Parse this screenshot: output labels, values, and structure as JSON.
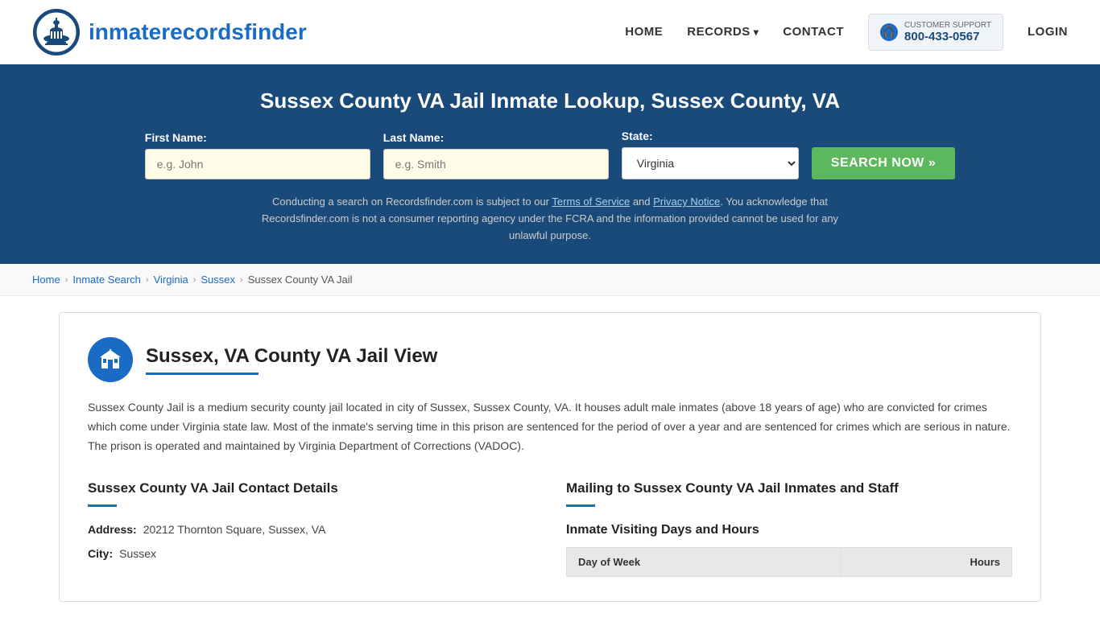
{
  "header": {
    "logo_text_part1": "inmaterecords",
    "logo_text_part2": "finder",
    "nav": {
      "home": "HOME",
      "records": "RECORDS",
      "contact": "CONTACT",
      "login": "LOGIN"
    },
    "support": {
      "label": "CUSTOMER SUPPORT",
      "number": "800-433-0567"
    }
  },
  "hero": {
    "title": "Sussex County VA Jail Inmate Lookup, Sussex County, VA",
    "form": {
      "first_name_label": "First Name:",
      "first_name_placeholder": "e.g. John",
      "last_name_label": "Last Name:",
      "last_name_placeholder": "e.g. Smith",
      "state_label": "State:",
      "state_value": "Virginia",
      "search_button": "SEARCH NOW »"
    },
    "disclaimer": "Conducting a search on Recordsfinder.com is subject to our Terms of Service and Privacy Notice. You acknowledge that Recordsfinder.com is not a consumer reporting agency under the FCRA and the information provided cannot be used for any unlawful purpose."
  },
  "breadcrumb": {
    "items": [
      {
        "label": "Home",
        "href": "#"
      },
      {
        "label": "Inmate Search",
        "href": "#"
      },
      {
        "label": "Virginia",
        "href": "#"
      },
      {
        "label": "Sussex",
        "href": "#"
      },
      {
        "label": "Sussex County VA Jail",
        "href": "#"
      }
    ]
  },
  "content": {
    "jail_title": "Sussex, VA County VA Jail View",
    "description": "Sussex County Jail is a medium security county jail located in city of Sussex, Sussex County, VA. It houses adult male inmates (above 18 years of age) who are convicted for crimes which come under Virginia state law. Most of the inmate's serving time in this prison are sentenced for the period of over a year and are sentenced for crimes which are serious in nature. The prison is operated and maintained by Virginia Department of Corrections (VADOC).",
    "contact_section_title": "Sussex County VA Jail Contact Details",
    "address_label": "Address:",
    "address_value": "20212 Thornton Square, Sussex, VA",
    "city_label": "City:",
    "city_value": "Sussex",
    "mailing_section_title": "Mailing to Sussex County VA Jail Inmates and Staff",
    "visiting_subtitle": "Inmate Visiting Days and Hours",
    "visiting_table_headers": [
      "Day of Week",
      "Hours"
    ]
  },
  "icons": {
    "capitol": "🏛",
    "jail": "🏢",
    "headset": "🎧",
    "chevron_right": "›",
    "chevron_down": "▾",
    "double_arrow": "»"
  }
}
